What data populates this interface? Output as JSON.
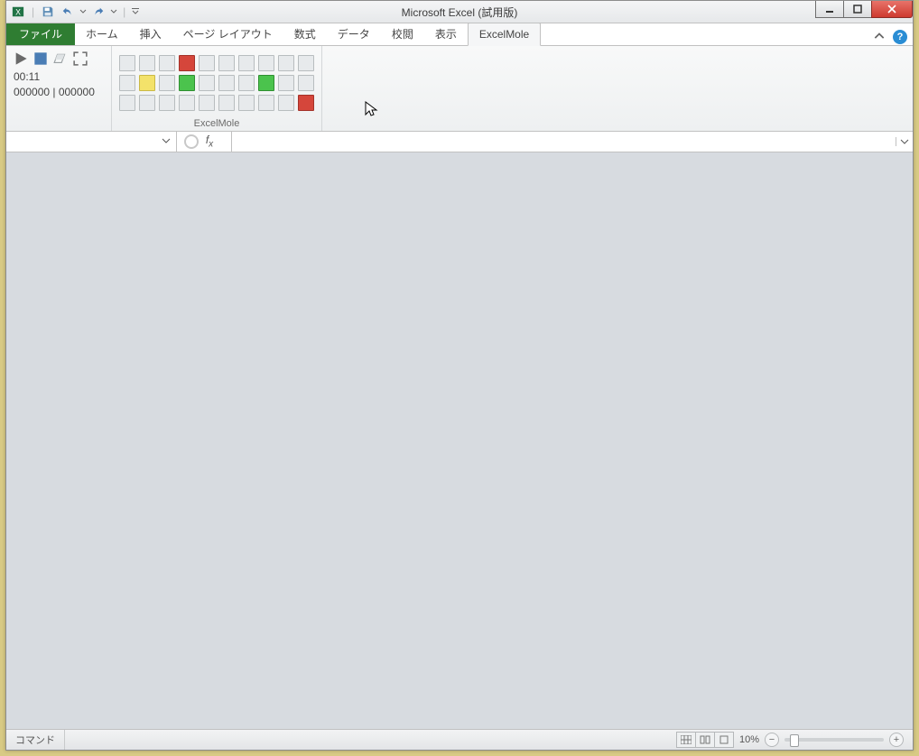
{
  "title": "Microsoft Excel (試用版)",
  "tabs": {
    "file": "ファイル",
    "home": "ホーム",
    "insert": "挿入",
    "pagelayout": "ページ レイアウト",
    "formulas": "数式",
    "data": "データ",
    "review": "校閲",
    "view": "表示",
    "excelmole": "ExcelMole"
  },
  "ribbon": {
    "timer": "00:11",
    "score": "000000 | 000000",
    "group_label": "ExcelMole"
  },
  "grid": [
    [
      "",
      "",
      "",
      "r",
      "",
      "",
      "",
      "",
      "",
      ""
    ],
    [
      "",
      "y",
      "",
      "g",
      "",
      "",
      "",
      "g",
      "",
      ""
    ],
    [
      "",
      "",
      "",
      "",
      "",
      "",
      "",
      "",
      "",
      "r"
    ]
  ],
  "status": {
    "left": "コマンド",
    "zoom": "10%"
  },
  "icons": {
    "play": "play-icon",
    "stop": "stop-icon",
    "erase": "erase-icon",
    "expand": "expand-icon"
  }
}
